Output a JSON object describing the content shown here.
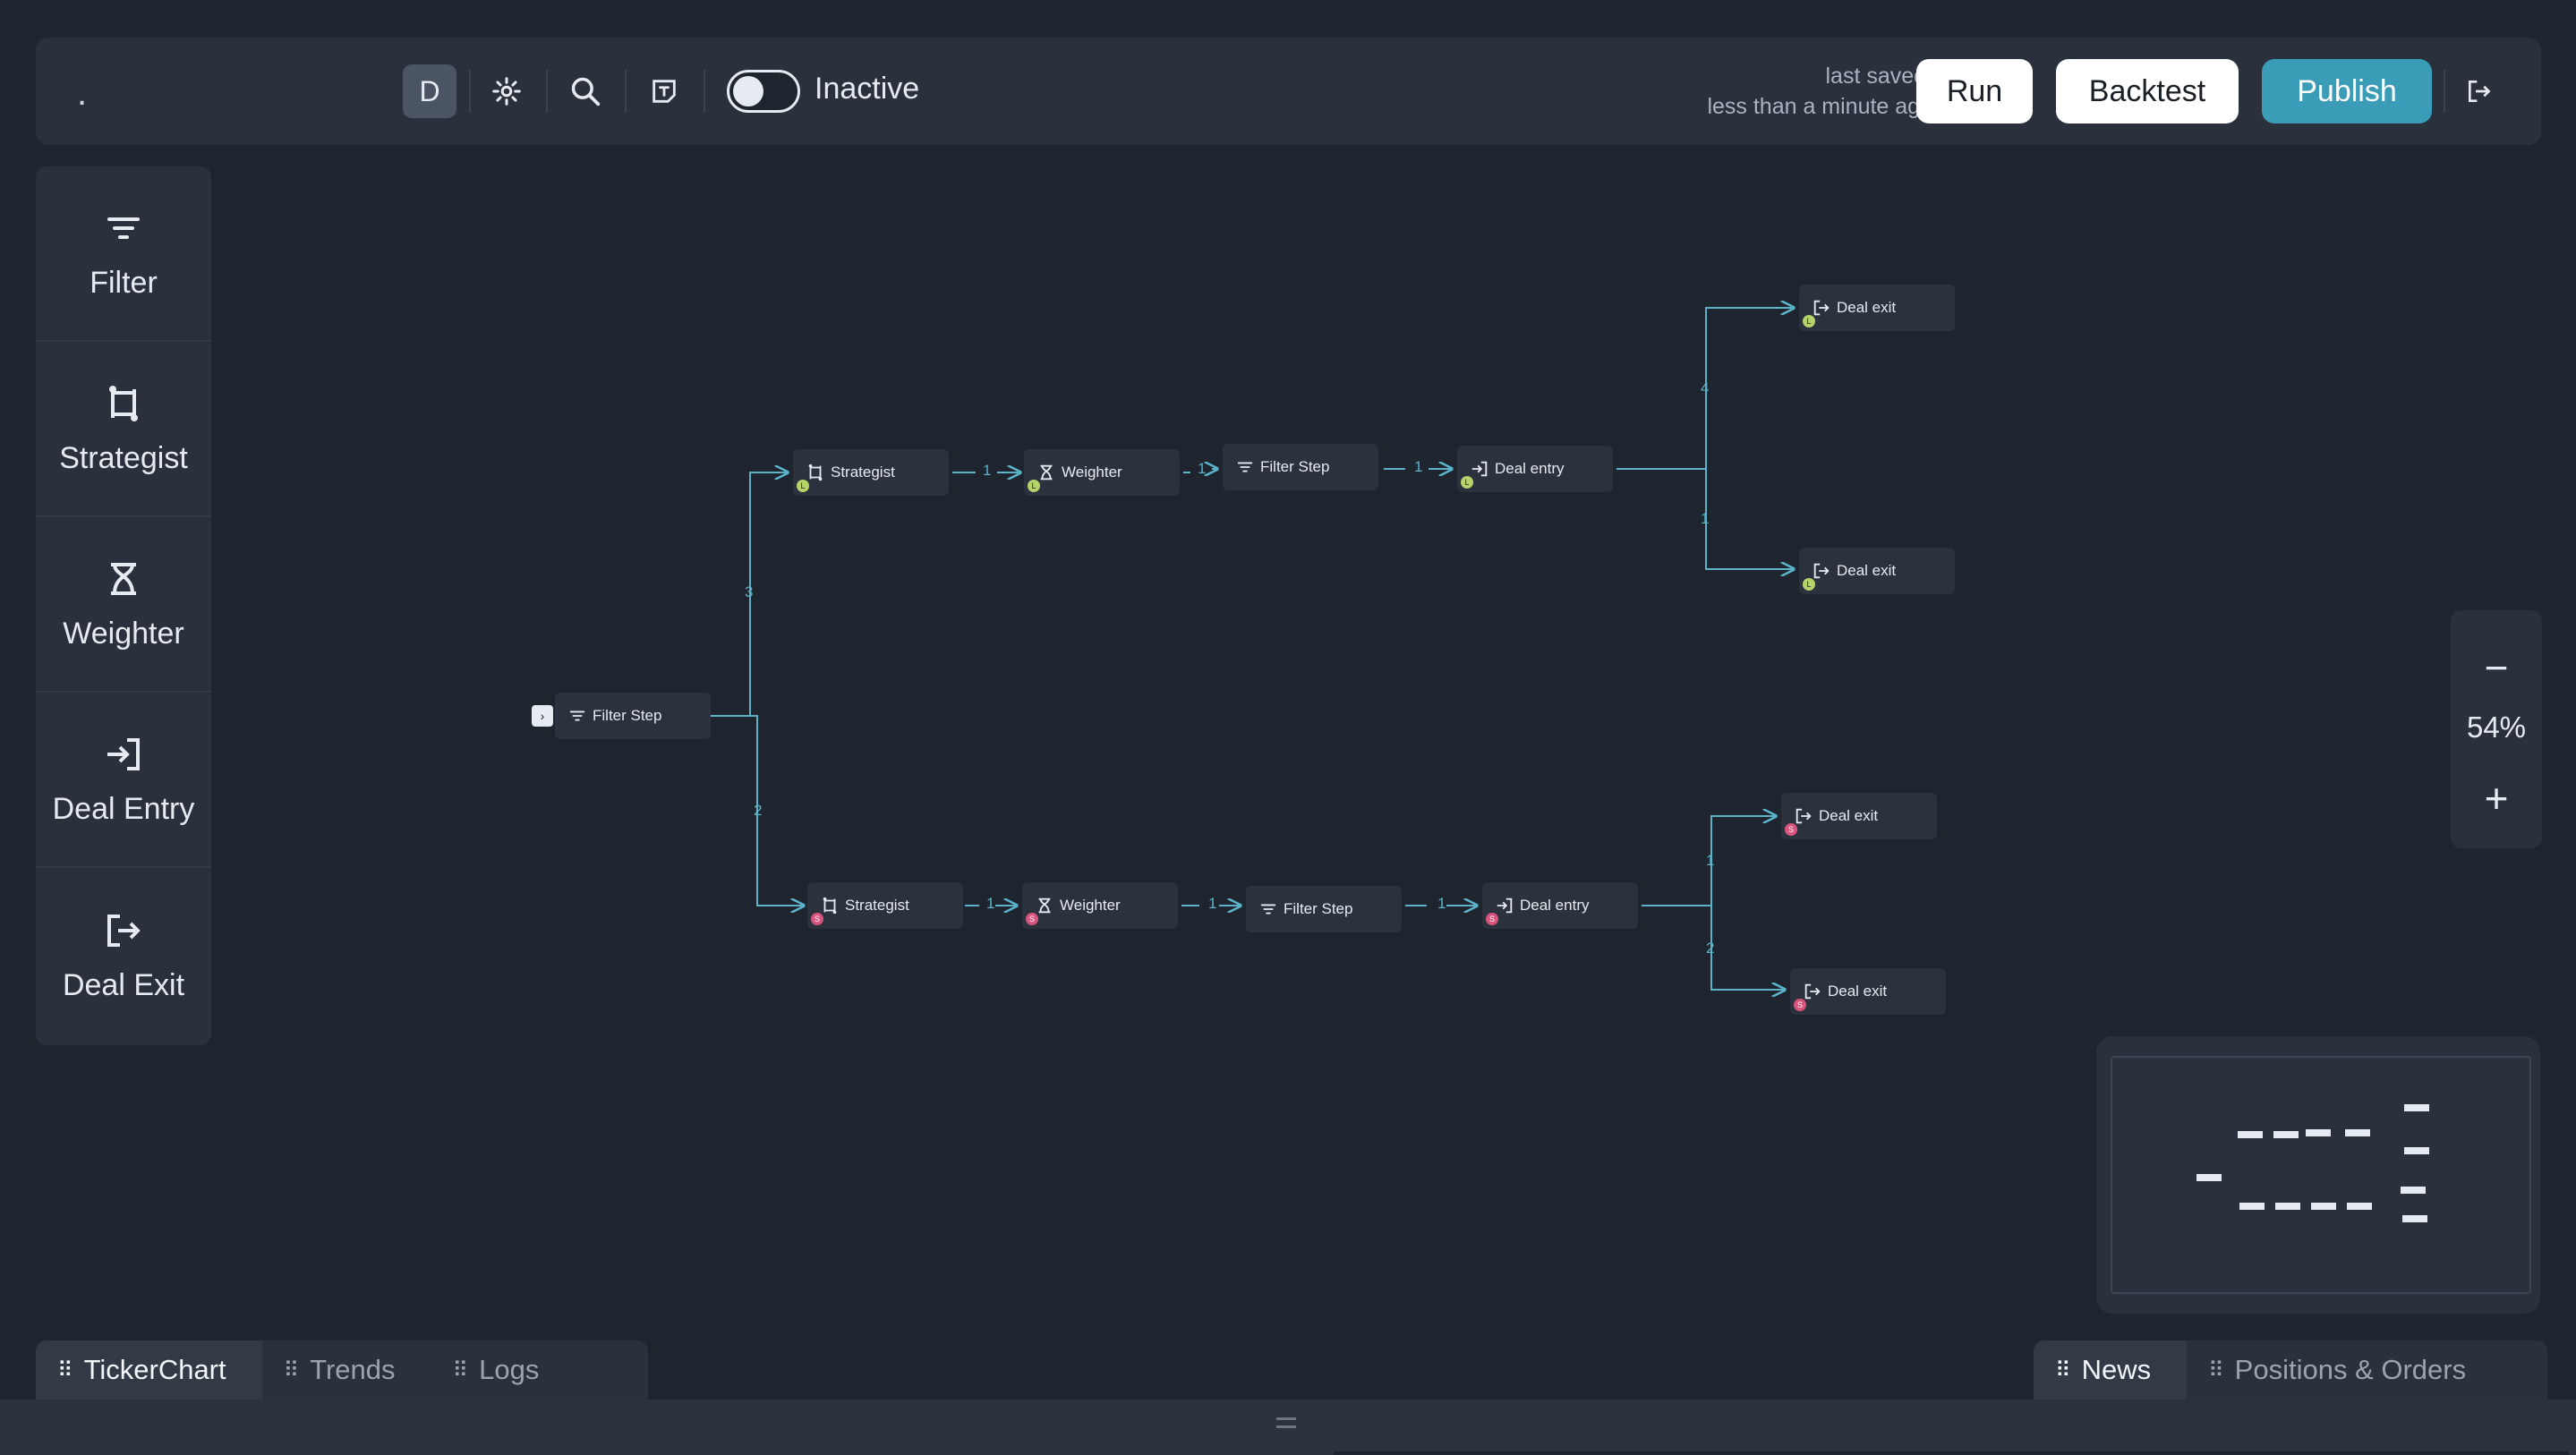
{
  "header": {
    "title": ".",
    "mode_button": "D",
    "status_toggle": {
      "label": "Inactive",
      "on": false
    },
    "last_saved_label": "last saved:",
    "last_saved_value": "less than a minute ago",
    "run_label": "Run",
    "backtest_label": "Backtest",
    "publish_label": "Publish",
    "icons": [
      "gear-icon",
      "search-icon",
      "template-icon",
      "logout-icon"
    ],
    "colors": {
      "publish_bg": "#3a9cb6",
      "panel_bg": "#2a313c",
      "canvas_bg": "#1f252e"
    }
  },
  "palette": {
    "items": [
      {
        "label": "Filter",
        "icon": "filter-icon"
      },
      {
        "label": "Strategist",
        "icon": "strategist-icon"
      },
      {
        "label": "Weighter",
        "icon": "weighter-icon"
      },
      {
        "label": "Deal Entry",
        "icon": "deal-entry-icon"
      },
      {
        "label": "Deal Exit",
        "icon": "deal-exit-icon"
      }
    ]
  },
  "flow": {
    "root": {
      "label": "Filter Step"
    },
    "branch_top": {
      "edge_label": "3",
      "strategist": "Strategist",
      "weighter": "Weighter",
      "filter": "Filter Step",
      "deal_entry": "Deal entry",
      "chain_labels": [
        "1",
        "1",
        "1"
      ],
      "exit_a": {
        "label": "Deal exit",
        "edge_label": "4"
      },
      "exit_b": {
        "label": "Deal exit",
        "edge_label": "1"
      },
      "badge": "L",
      "badge_color": "#b6d36a"
    },
    "branch_bottom": {
      "edge_label": "2",
      "strategist": "Strategist",
      "weighter": "Weighter",
      "filter": "Filter Step",
      "deal_entry": "Deal entry",
      "chain_labels": [
        "1",
        "1",
        "1"
      ],
      "exit_a": {
        "label": "Deal exit",
        "edge_label": "1"
      },
      "exit_b": {
        "label": "Deal exit",
        "edge_label": "2"
      },
      "badge": "S",
      "badge_color": "#d9557e"
    }
  },
  "zoom": {
    "minus": "−",
    "value": "54%",
    "plus": "+"
  },
  "bottom_tabs_left": [
    "TickerChart",
    "Trends",
    "Logs"
  ],
  "bottom_tabs_right": [
    "News",
    "Positions & Orders"
  ]
}
